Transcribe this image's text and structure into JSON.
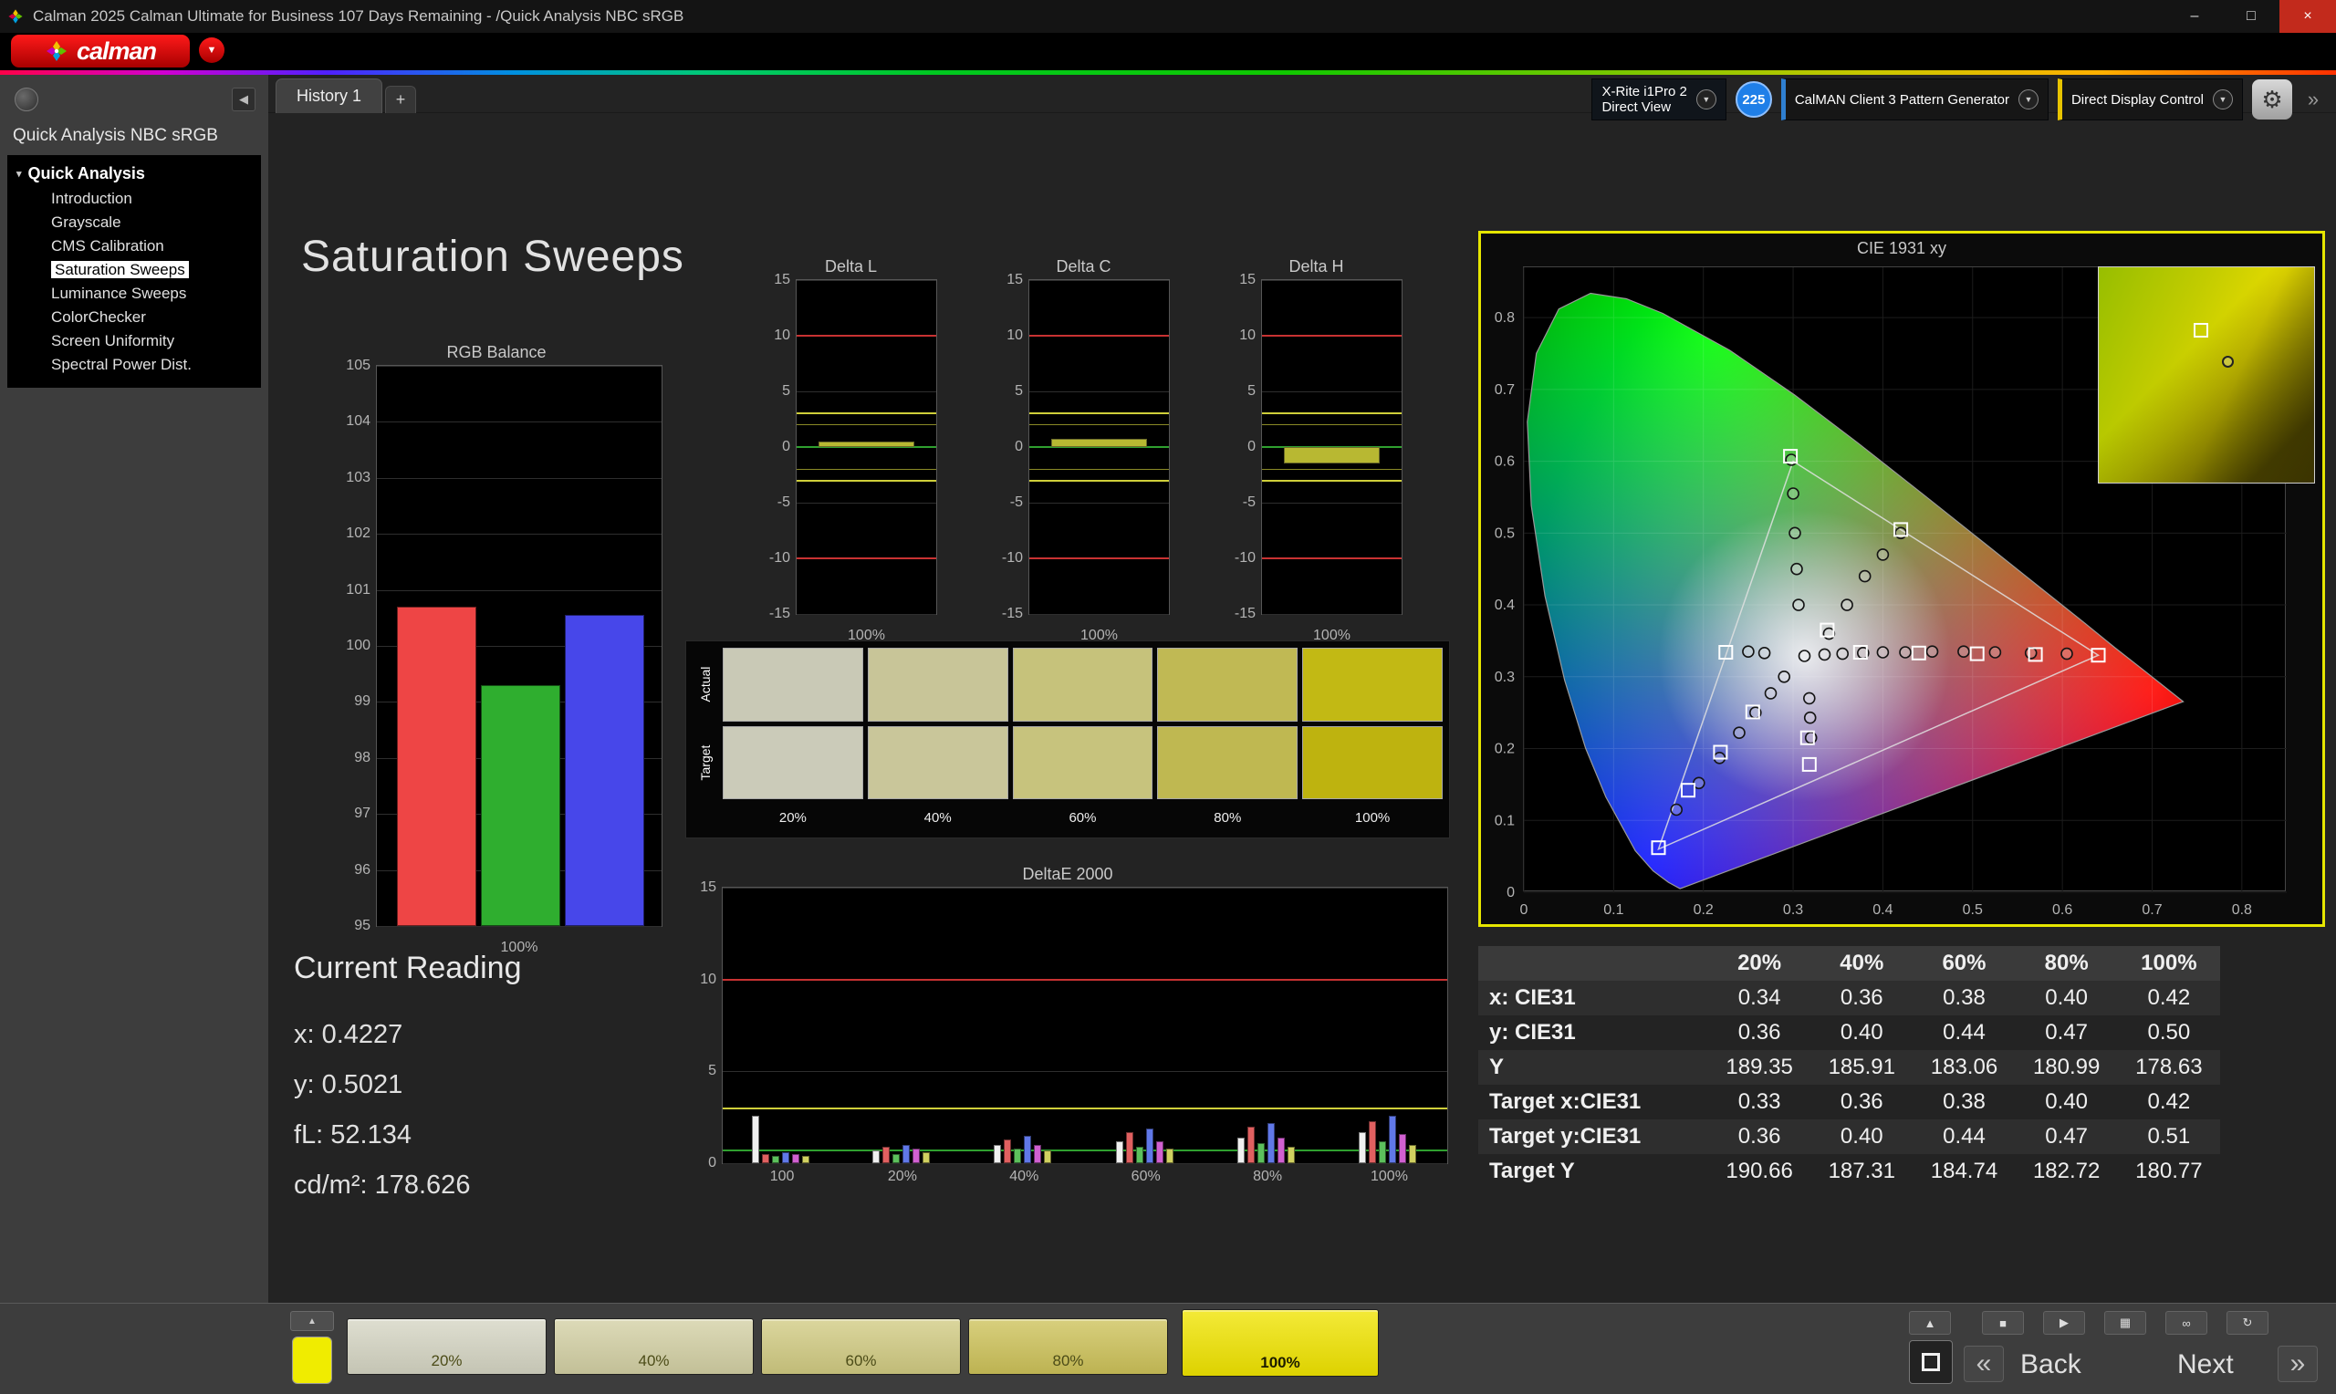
{
  "titlebar": {
    "title": "Calman 2025 Calman Ultimate for Business 107 Days Remaining  - /Quick Analysis NBC sRGB",
    "minimize": "–",
    "maximize": "□",
    "close": "×"
  },
  "logo": {
    "brand": "calman",
    "dropdown_icon": "▼"
  },
  "tabbar": {
    "history_tab": "History 1",
    "add_tab": "+"
  },
  "devices": {
    "meter_line1": "X-Rite i1Pro 2",
    "meter_line2": "Direct View",
    "badge": "225",
    "pattern_generator": "CalMAN Client 3 Pattern Generator",
    "display_control": "Direct Display Control",
    "gear_icon": "⚙",
    "collapse_icon": "»",
    "dropdown_icon": "▼"
  },
  "sidebar": {
    "workflow_title": "Quick Analysis NBC sRGB",
    "root": "Quick Analysis",
    "selected": "Saturation Sweeps",
    "items": [
      {
        "label": "Introduction"
      },
      {
        "label": "Grayscale"
      },
      {
        "label": "CMS Calibration"
      },
      {
        "label": "Saturation Sweeps"
      },
      {
        "label": "Luminance Sweeps"
      },
      {
        "label": "ColorChecker"
      },
      {
        "label": "Screen Uniformity"
      },
      {
        "label": "Spectral Power Dist."
      }
    ]
  },
  "page": {
    "title": "Saturation Sweeps"
  },
  "rgb_balance": {
    "type": "bar",
    "title": "RGB Balance",
    "ylim": [
      95,
      105
    ],
    "yticks": [
      105,
      104,
      103,
      102,
      101,
      100,
      99,
      98,
      97,
      96,
      95
    ],
    "xlabel": "100%",
    "bars": [
      {
        "name": "red",
        "color": "#ee4545",
        "value": 100.7
      },
      {
        "name": "green",
        "color": "#2fae2f",
        "value": 99.3
      },
      {
        "name": "blue",
        "color": "#4747ea",
        "value": 100.55
      }
    ]
  },
  "delta_config": {
    "ylim": [
      -15,
      15
    ],
    "yticks": [
      15,
      10,
      5,
      0,
      -5,
      -10,
      -15
    ],
    "red_limit": 10,
    "yellow_limit": 3,
    "yellow_inner": 2,
    "bar_color": "#b8b832",
    "xlabel": "100%"
  },
  "delta_charts": [
    {
      "title": "Delta L",
      "value": 0.5
    },
    {
      "title": "Delta C",
      "value": 0.7
    },
    {
      "title": "Delta H",
      "value": -1.5
    }
  ],
  "swatches": {
    "row_labels": [
      "Actual",
      "Target"
    ],
    "col_labels": [
      "20%",
      "40%",
      "60%",
      "80%",
      "100%"
    ],
    "actual": [
      "#c9c9b6",
      "#c8c598",
      "#c6c27b",
      "#c0b954",
      "#c2b914"
    ],
    "target": [
      "#cbcbb9",
      "#c9c69a",
      "#c7c37d",
      "#bfb851",
      "#beb30f"
    ]
  },
  "deltae": {
    "type": "bar",
    "title": "DeltaE 2000",
    "ymax": 15,
    "yticks": [
      15,
      10,
      5,
      0
    ],
    "red_limit": 10,
    "yellow_limit": 3,
    "green_line": 0.7,
    "xlabels": [
      "100",
      "20%",
      "40%",
      "60%",
      "80%",
      "100%"
    ],
    "bar_colors": [
      "#f0f0f0",
      "#e06060",
      "#5cc05c",
      "#6078e8",
      "#d060d0",
      "#d0d060"
    ],
    "groups": [
      [
        2.6,
        0.5,
        0.4,
        0.6,
        0.5,
        0.4
      ],
      [
        0.7,
        0.9,
        0.5,
        1.0,
        0.8,
        0.6
      ],
      [
        1.0,
        1.3,
        0.8,
        1.5,
        1.0,
        0.7
      ],
      [
        1.2,
        1.7,
        0.9,
        1.9,
        1.2,
        0.8
      ],
      [
        1.4,
        2.0,
        1.1,
        2.2,
        1.4,
        0.9
      ],
      [
        1.7,
        2.3,
        1.2,
        2.6,
        1.6,
        1.0
      ]
    ]
  },
  "current_reading": {
    "title": "Current Reading",
    "lines": [
      "x: 0.4227",
      "y: 0.5021",
      "fL: 52.134",
      "cd/m²: 178.626"
    ]
  },
  "cie": {
    "type": "scatter",
    "title": "CIE 1931 xy",
    "xticks": [
      0,
      0.1,
      0.2,
      0.3,
      0.4,
      0.5,
      0.6,
      0.7,
      0.8
    ],
    "yticks": [
      0,
      0.1,
      0.2,
      0.3,
      0.4,
      0.5,
      0.6,
      0.7,
      0.8
    ],
    "locus": [
      [
        0.1741,
        0.005
      ],
      [
        0.1611,
        0.0138
      ],
      [
        0.144,
        0.0297
      ],
      [
        0.1241,
        0.0578
      ],
      [
        0.0913,
        0.1327
      ],
      [
        0.0687,
        0.2007
      ],
      [
        0.0454,
        0.295
      ],
      [
        0.0235,
        0.4127
      ],
      [
        0.0082,
        0.5384
      ],
      [
        0.0039,
        0.6548
      ],
      [
        0.0139,
        0.7502
      ],
      [
        0.0389,
        0.812
      ],
      [
        0.0743,
        0.8338
      ],
      [
        0.1142,
        0.8262
      ],
      [
        0.1547,
        0.8059
      ],
      [
        0.2296,
        0.7543
      ],
      [
        0.3016,
        0.6923
      ],
      [
        0.3731,
        0.6245
      ],
      [
        0.4441,
        0.5547
      ],
      [
        0.5125,
        0.4866
      ],
      [
        0.5752,
        0.4242
      ],
      [
        0.627,
        0.3725
      ],
      [
        0.6588,
        0.3403
      ],
      [
        0.6915,
        0.3083
      ],
      [
        0.7347,
        0.2653
      ]
    ],
    "gamut": [
      [
        0.64,
        0.33
      ],
      [
        0.3,
        0.6
      ],
      [
        0.15,
        0.06
      ]
    ],
    "squares": [
      [
        0.375,
        0.334
      ],
      [
        0.44,
        0.333
      ],
      [
        0.505,
        0.332
      ],
      [
        0.57,
        0.331
      ],
      [
        0.64,
        0.33
      ],
      [
        0.297,
        0.607
      ],
      [
        0.338,
        0.365
      ],
      [
        0.42,
        0.505
      ],
      [
        0.255,
        0.251
      ],
      [
        0.219,
        0.195
      ],
      [
        0.183,
        0.142
      ],
      [
        0.15,
        0.062
      ],
      [
        0.316,
        0.215
      ],
      [
        0.318,
        0.178
      ],
      [
        0.225,
        0.334
      ]
    ],
    "circles": [
      [
        0.3127,
        0.329
      ],
      [
        0.335,
        0.331
      ],
      [
        0.355,
        0.332
      ],
      [
        0.378,
        0.333
      ],
      [
        0.4,
        0.334
      ],
      [
        0.425,
        0.334
      ],
      [
        0.455,
        0.335
      ],
      [
        0.49,
        0.335
      ],
      [
        0.525,
        0.334
      ],
      [
        0.565,
        0.333
      ],
      [
        0.605,
        0.332
      ],
      [
        0.306,
        0.4
      ],
      [
        0.304,
        0.45
      ],
      [
        0.302,
        0.5
      ],
      [
        0.3,
        0.555
      ],
      [
        0.298,
        0.602
      ],
      [
        0.34,
        0.36
      ],
      [
        0.36,
        0.4
      ],
      [
        0.38,
        0.44
      ],
      [
        0.4,
        0.47
      ],
      [
        0.42,
        0.5
      ],
      [
        0.29,
        0.3
      ],
      [
        0.275,
        0.277
      ],
      [
        0.258,
        0.25
      ],
      [
        0.24,
        0.222
      ],
      [
        0.218,
        0.187
      ],
      [
        0.195,
        0.152
      ],
      [
        0.17,
        0.115
      ],
      [
        0.318,
        0.27
      ],
      [
        0.319,
        0.243
      ],
      [
        0.32,
        0.215
      ],
      [
        0.25,
        0.335
      ],
      [
        0.268,
        0.333
      ]
    ]
  },
  "table": {
    "header": [
      "",
      "20%",
      "40%",
      "60%",
      "80%",
      "100%"
    ],
    "rows": [
      {
        "label": "x: CIE31",
        "values": [
          "0.34",
          "0.36",
          "0.38",
          "0.40",
          "0.42"
        ]
      },
      {
        "label": "y: CIE31",
        "values": [
          "0.36",
          "0.40",
          "0.44",
          "0.47",
          "0.50"
        ]
      },
      {
        "label": "Y",
        "values": [
          "189.35",
          "185.91",
          "183.06",
          "180.99",
          "178.63"
        ]
      },
      {
        "label": "Target x:CIE31",
        "values": [
          "0.33",
          "0.36",
          "0.38",
          "0.40",
          "0.42"
        ]
      },
      {
        "label": "Target y:CIE31",
        "values": [
          "0.36",
          "0.40",
          "0.44",
          "0.47",
          "0.51"
        ]
      },
      {
        "label": "Target Y",
        "values": [
          "190.66",
          "187.31",
          "184.74",
          "182.72",
          "180.77"
        ]
      }
    ]
  },
  "bottombar": {
    "swatch_buttons": [
      {
        "label": "20%",
        "color": "#d5d5c3",
        "active": false
      },
      {
        "label": "40%",
        "color": "#d3d0a4",
        "active": false
      },
      {
        "label": "60%",
        "color": "#d1cb82",
        "active": false
      },
      {
        "label": "80%",
        "color": "#cdc259",
        "active": false
      },
      {
        "label": "100%",
        "color": "#f0e400",
        "active": true
      }
    ],
    "transport": [
      {
        "name": "panel-up",
        "glyph": "▲"
      },
      {
        "name": "stop",
        "glyph": "■"
      },
      {
        "name": "play",
        "glyph": "▶"
      },
      {
        "name": "save",
        "glyph": "▦"
      },
      {
        "name": "continuous",
        "glyph": "∞"
      },
      {
        "name": "refresh",
        "glyph": "↻"
      }
    ],
    "back": "Back",
    "next": "Next",
    "prev_icon": "«",
    "next_icon": "»"
  }
}
